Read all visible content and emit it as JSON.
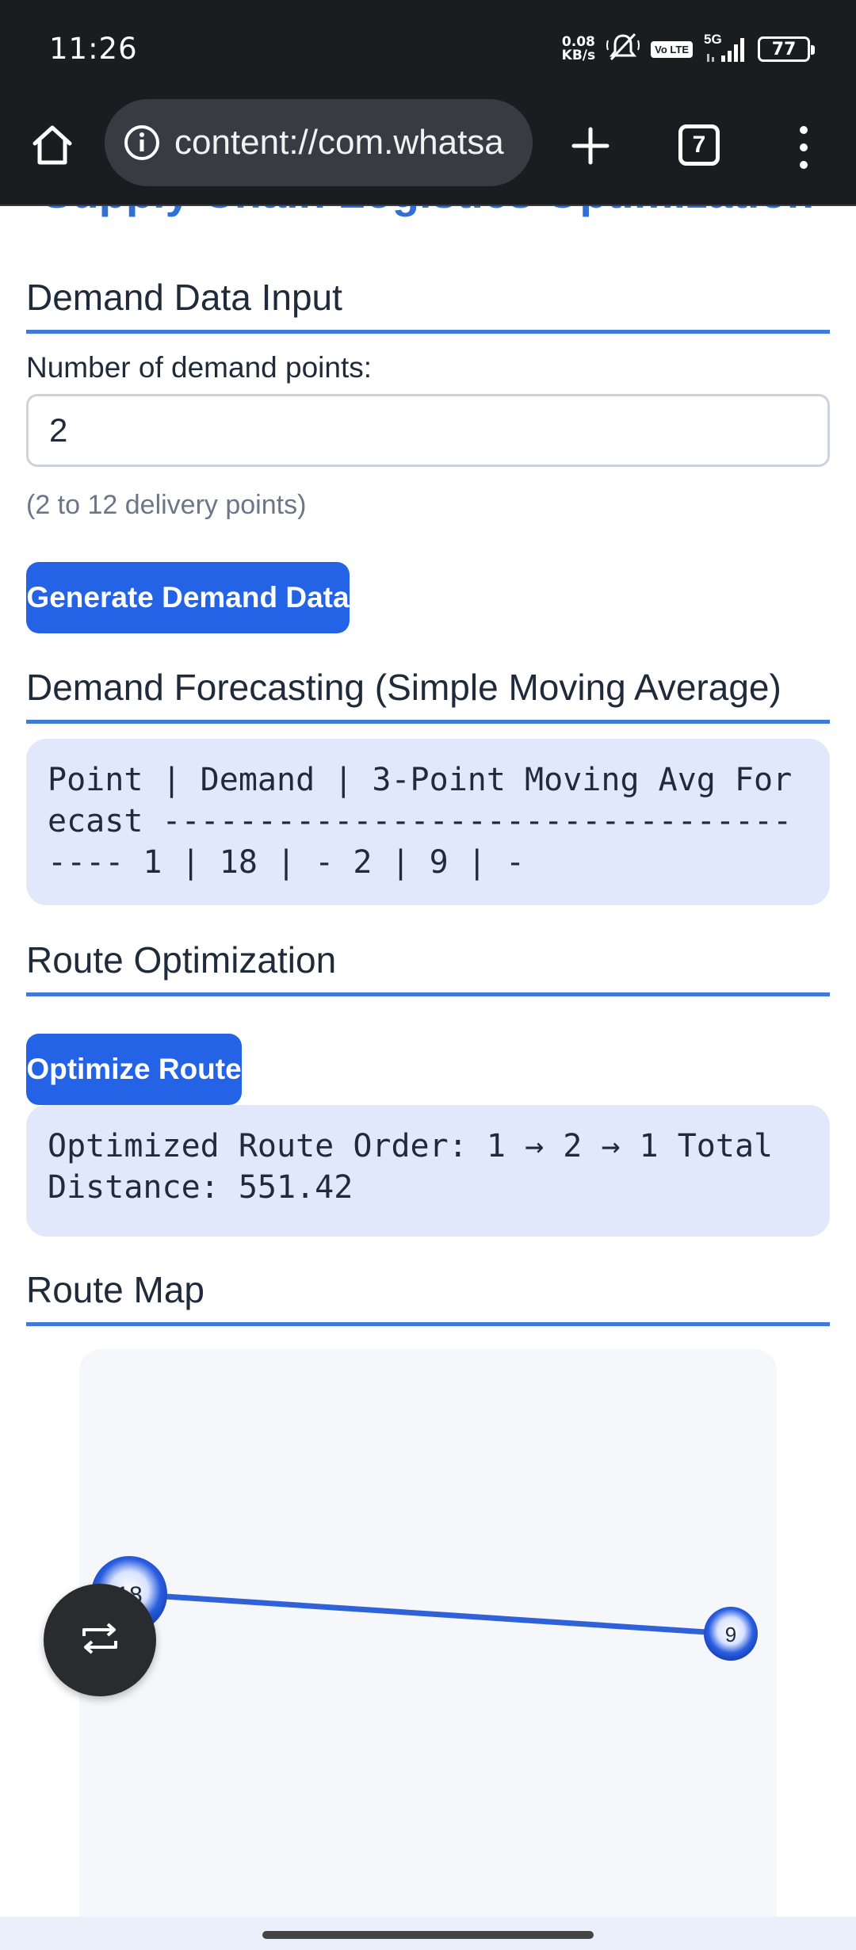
{
  "status_bar": {
    "time": "11:26",
    "net_speed_value": "0.08",
    "net_speed_unit": "KB/s",
    "volte": "Vo LTE",
    "network": "5G",
    "battery": "77"
  },
  "browser": {
    "url": "content://com.whatsa",
    "tab_count": "7"
  },
  "app": {
    "title": "Supply Chain Logistics Optimization"
  },
  "demand_input": {
    "heading": "Demand Data Input",
    "label": "Number of demand points:",
    "value": "2",
    "hint": "(2 to 12 delivery points)",
    "button": "Generate Demand Data"
  },
  "forecast": {
    "heading": "Demand Forecasting (Simple Moving Average)",
    "output": "Point | Demand | 3-Point Moving Avg Forecast ------------------------------------- 1 | 18 | - 2 | 9 | -"
  },
  "route": {
    "heading": "Route Optimization",
    "button": "Optimize Route",
    "output": "Optimized Route Order: 1 → 2 → 1 Total Distance: 551.42"
  },
  "route_map": {
    "heading": "Route Map",
    "nodes": [
      {
        "label": "18"
      },
      {
        "label": "9"
      }
    ]
  },
  "icons": {
    "home": "home-icon",
    "info": "info-icon",
    "new_tab": "plus-icon",
    "menu": "more-vert-icon",
    "fab": "swap-icon"
  },
  "colors": {
    "accent": "#2563e6",
    "heading_rule": "#3f7ad9",
    "output_bg": "#e1e8fb",
    "route_line": "#2f62d8",
    "node_fill": "#1f4fcf"
  }
}
